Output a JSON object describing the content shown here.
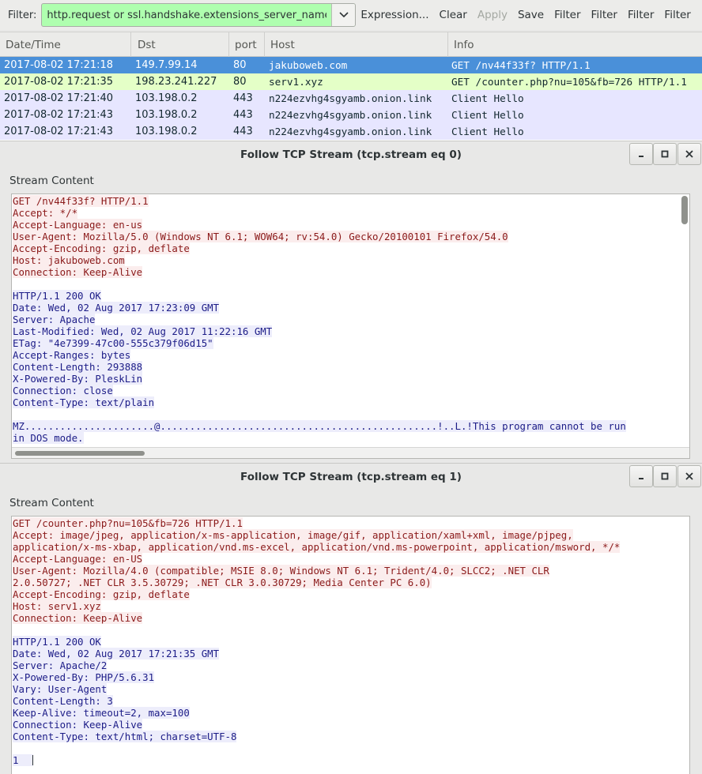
{
  "toolbar": {
    "filter_label": "Filter:",
    "filter_value": "http.request or ssl.handshake.extensions_server_name",
    "buttons": [
      "Expression...",
      "Clear",
      "Apply",
      "Save",
      "Filter",
      "Filter",
      "Filter",
      "Filter"
    ],
    "apply_disabled": true,
    "filter_bg": "#afffaf"
  },
  "packet_list": {
    "columns": [
      "Date/Time",
      "Dst",
      "port",
      "Host",
      "Info"
    ],
    "rows": [
      {
        "datetime": "2017-08-02 17:21:18",
        "dst": "149.7.99.14",
        "port": "80",
        "host": "jakuboweb.com",
        "info": "GET /nv44f33f? HTTP/1.1",
        "selected": true,
        "bg": "#4a90d9",
        "fg": "#ffffff"
      },
      {
        "datetime": "2017-08-02 17:21:35",
        "dst": "198.23.241.227",
        "port": "80",
        "host": "serv1.xyz",
        "info": "GET /counter.php?nu=105&fb=726 HTTP/1.1",
        "bg": "#e4ffc7",
        "fg": "#12272e"
      },
      {
        "datetime": "2017-08-02 17:21:40",
        "dst": "103.198.0.2",
        "port": "443",
        "host": "n224ezvhg4sgyamb.onion.link",
        "info": "Client Hello",
        "bg": "#e7e6ff",
        "fg": "#12272e"
      },
      {
        "datetime": "2017-08-02 17:21:43",
        "dst": "103.198.0.2",
        "port": "443",
        "host": "n224ezvhg4sgyamb.onion.link",
        "info": "Client Hello",
        "bg": "#e7e6ff",
        "fg": "#12272e"
      },
      {
        "datetime": "2017-08-02 17:21:43",
        "dst": "103.198.0.2",
        "port": "443",
        "host": "n224ezvhg4sgyamb.onion.link",
        "info": "Client Hello",
        "bg": "#e7e6ff",
        "fg": "#12272e"
      }
    ]
  },
  "stream0": {
    "title": "Follow TCP Stream (tcp.stream eq 0)",
    "content_label": "Stream Content",
    "lines": [
      {
        "t": "GET /nv44f33f? HTTP/1.1",
        "k": "c"
      },
      {
        "t": "Accept: */*",
        "k": "c"
      },
      {
        "t": "Accept-Language: en-us",
        "k": "c"
      },
      {
        "t": "User-Agent: Mozilla/5.0 (Windows NT 6.1; WOW64; rv:54.0) Gecko/20100101 Firefox/54.0",
        "k": "c"
      },
      {
        "t": "Accept-Encoding: gzip, deflate",
        "k": "c"
      },
      {
        "t": "Host: jakuboweb.com",
        "k": "c"
      },
      {
        "t": "Connection: Keep-Alive",
        "k": "c"
      },
      {
        "t": "",
        "k": "blank"
      },
      {
        "t": "HTTP/1.1 200 OK",
        "k": "s"
      },
      {
        "t": "Date: Wed, 02 Aug 2017 17:23:09 GMT",
        "k": "s"
      },
      {
        "t": "Server: Apache",
        "k": "s"
      },
      {
        "t": "Last-Modified: Wed, 02 Aug 2017 11:22:16 GMT",
        "k": "s"
      },
      {
        "t": "ETag: \"4e7399-47c00-555c379f06d15\"",
        "k": "s"
      },
      {
        "t": "Accept-Ranges: bytes",
        "k": "s"
      },
      {
        "t": "Content-Length: 293888",
        "k": "s"
      },
      {
        "t": "X-Powered-By: PleskLin",
        "k": "s"
      },
      {
        "t": "Connection: close",
        "k": "s"
      },
      {
        "t": "Content-Type: text/plain",
        "k": "s"
      },
      {
        "t": "",
        "k": "blank"
      },
      {
        "t": "MZ......................@...............................................!..L.!This program cannot be run",
        "k": "s"
      },
      {
        "t": "in DOS mode.",
        "k": "s"
      }
    ]
  },
  "stream1": {
    "title": "Follow TCP Stream (tcp.stream eq 1)",
    "content_label": "Stream Content",
    "lines": [
      {
        "t": "GET /counter.php?nu=105&fb=726 HTTP/1.1",
        "k": "c"
      },
      {
        "t": "Accept: image/jpeg, application/x-ms-application, image/gif, application/xaml+xml, image/pjpeg,",
        "k": "c"
      },
      {
        "t": "application/x-ms-xbap, application/vnd.ms-excel, application/vnd.ms-powerpoint, application/msword, */*",
        "k": "c"
      },
      {
        "t": "Accept-Language: en-US",
        "k": "c"
      },
      {
        "t": "User-Agent: Mozilla/4.0 (compatible; MSIE 8.0; Windows NT 6.1; Trident/4.0; SLCC2; .NET CLR",
        "k": "c"
      },
      {
        "t": "2.0.50727; .NET CLR 3.5.30729; .NET CLR 3.0.30729; Media Center PC 6.0)",
        "k": "c"
      },
      {
        "t": "Accept-Encoding: gzip, deflate",
        "k": "c"
      },
      {
        "t": "Host: serv1.xyz",
        "k": "c"
      },
      {
        "t": "Connection: Keep-Alive",
        "k": "c"
      },
      {
        "t": "",
        "k": "blank"
      },
      {
        "t": "HTTP/1.1 200 OK",
        "k": "s"
      },
      {
        "t": "Date: Wed, 02 Aug 2017 17:21:35 GMT",
        "k": "s"
      },
      {
        "t": "Server: Apache/2",
        "k": "s"
      },
      {
        "t": "X-Powered-By: PHP/5.6.31",
        "k": "s"
      },
      {
        "t": "Vary: User-Agent",
        "k": "s"
      },
      {
        "t": "Content-Length: 3",
        "k": "s"
      },
      {
        "t": "Keep-Alive: timeout=2, max=100",
        "k": "s"
      },
      {
        "t": "Connection: Keep-Alive",
        "k": "s"
      },
      {
        "t": "Content-Type: text/html; charset=UTF-8",
        "k": "s"
      },
      {
        "t": "",
        "k": "blank"
      },
      {
        "t": "1",
        "k": "s",
        "caret": true
      }
    ]
  },
  "icons": {
    "minimize": "minimize-icon",
    "maximize": "maximize-icon",
    "close": "close-icon",
    "dropdown": "chevron-down-icon"
  }
}
